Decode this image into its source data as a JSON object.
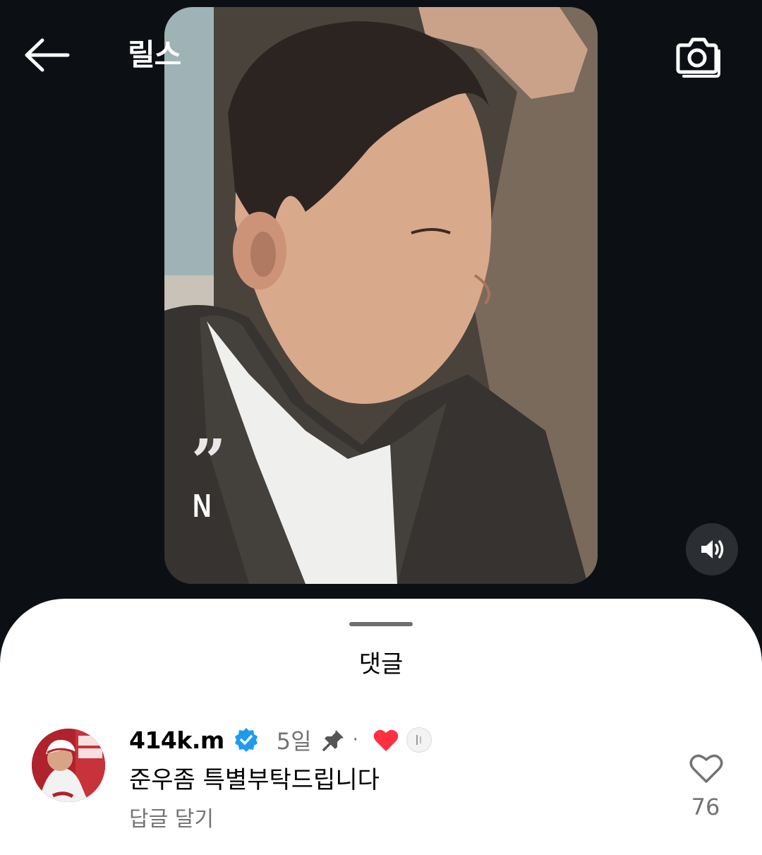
{
  "header": {
    "title": "릴스",
    "back_icon": "arrow-left-icon",
    "camera_icon": "camera-icon"
  },
  "video": {
    "overlay_quote": "”",
    "overlay_letter": "N",
    "volume_icon": "volume-on-icon"
  },
  "comments_sheet": {
    "title": "댓글",
    "comments": [
      {
        "username": "414k.m",
        "verified": true,
        "time": "5일",
        "pinned": true,
        "separator": "·",
        "liked_by_author": true,
        "text": "준우좀 특별부탁드립니다",
        "reply_label": "답글 달기",
        "like_count": "76"
      }
    ]
  },
  "colors": {
    "background_dark": "#0c1014",
    "sheet_background": "#ffffff",
    "secondary_text": "#737373",
    "verified_blue": "#1d9bf0",
    "heart_red": "#ff3040"
  }
}
